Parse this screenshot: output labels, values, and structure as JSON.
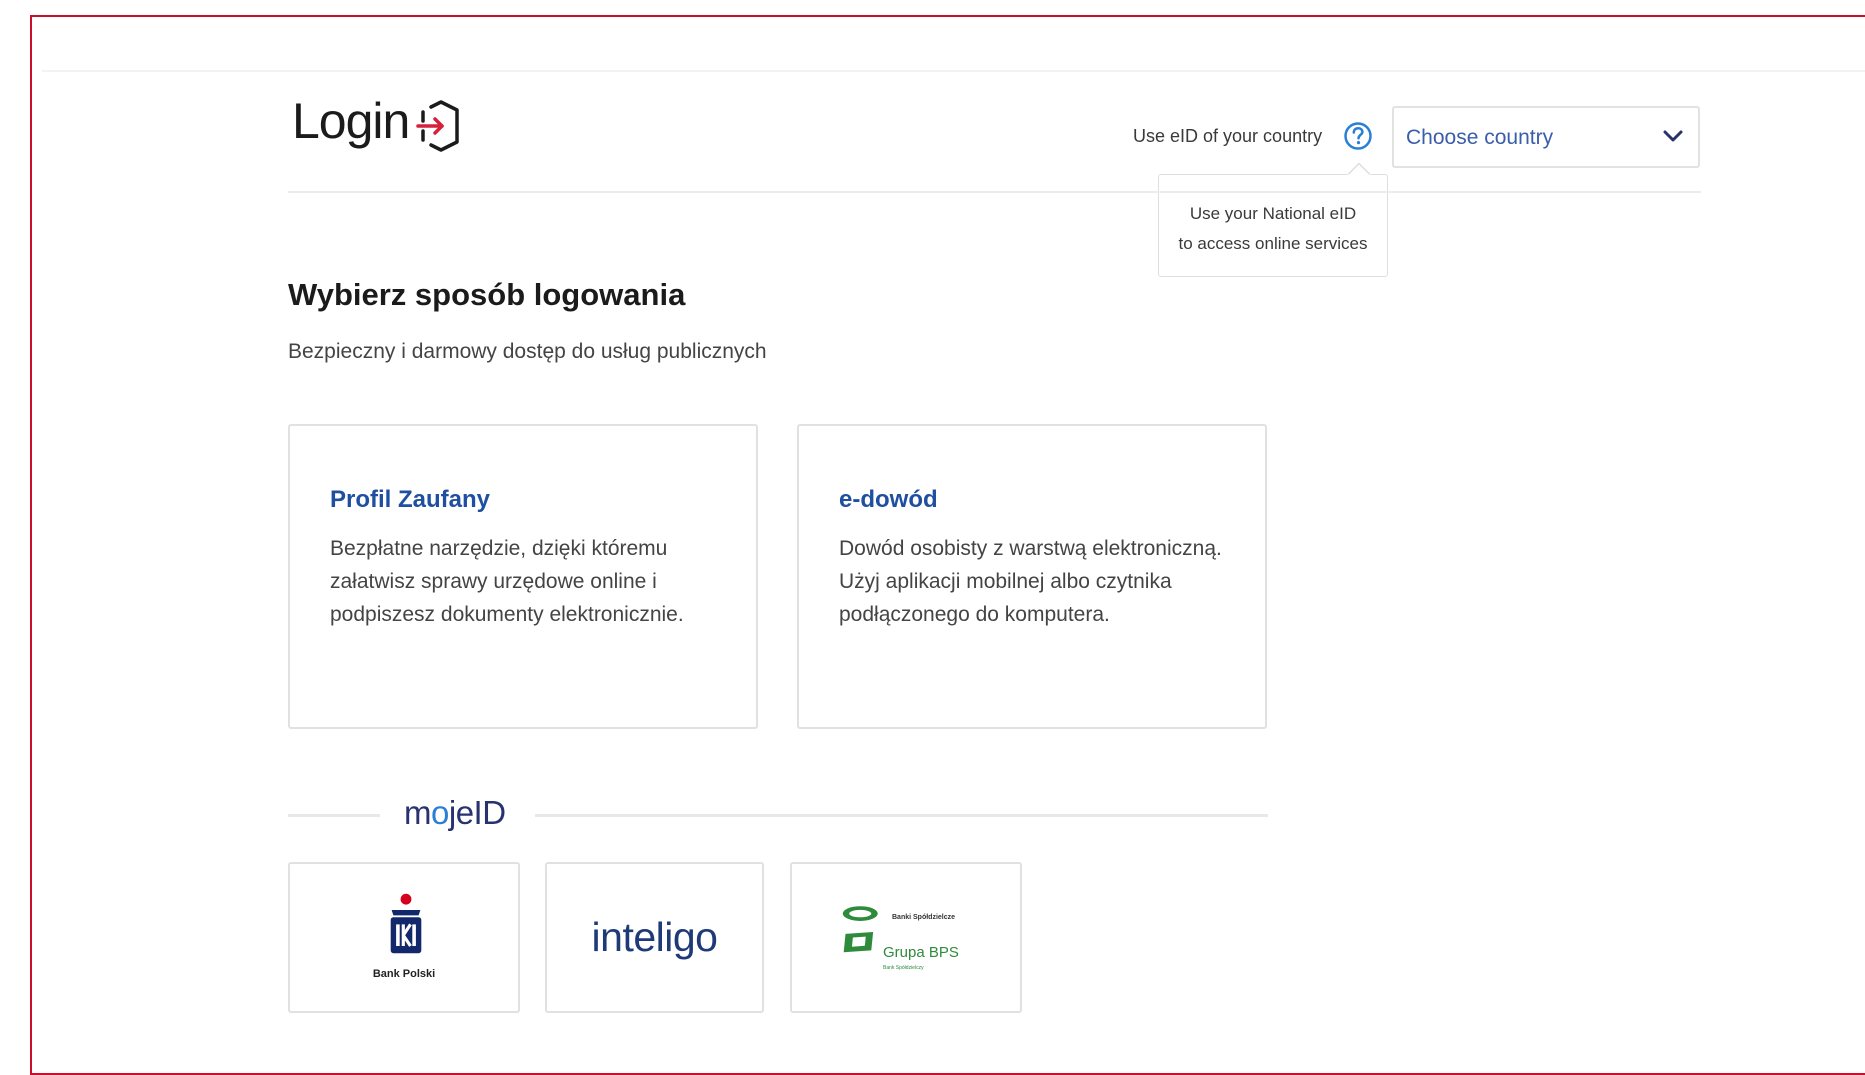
{
  "header": {
    "title": "Login",
    "eid_label": "Use eID of your country",
    "country_select": {
      "placeholder": "Choose country"
    },
    "tooltip": {
      "line1": "Use your National eID",
      "line2": "to access online services"
    }
  },
  "main": {
    "title": "Wybierz sposób logowania",
    "subtitle": "Bezpieczny i darmowy dostęp do usług publicznych",
    "cards": [
      {
        "title": "Profil Zaufany",
        "description": "Bezpłatne narzędzie, dzięki któremu załatwisz sprawy urzędowe online i podpiszesz dokumenty elektronicznie."
      },
      {
        "title": "e-dowód",
        "description": "Dowód osobisty z warstwą elektroniczną. Użyj aplikacji mobilnej albo czytnika podłączonego do komputera."
      }
    ]
  },
  "mojeid": {
    "logo_part1": "m",
    "logo_part2": "o",
    "logo_part3": "jeID",
    "banks": [
      {
        "name": "PKO",
        "caption": "Bank Polski"
      },
      {
        "name": "inteligo"
      },
      {
        "top": "Banki Spółdzielcze",
        "main": "Grupa BPS",
        "sub": "Bank Spółdzielczy"
      }
    ]
  },
  "colors": {
    "frame": "#c8102e",
    "link_blue": "#1f4fa0",
    "select_text": "#3a5eaa",
    "help_icon": "#2a7fd4",
    "login_icon_accent": "#d6213a",
    "pko_red": "#d6001c",
    "pko_navy": "#13286b",
    "bps_green": "#2e8b3c"
  }
}
